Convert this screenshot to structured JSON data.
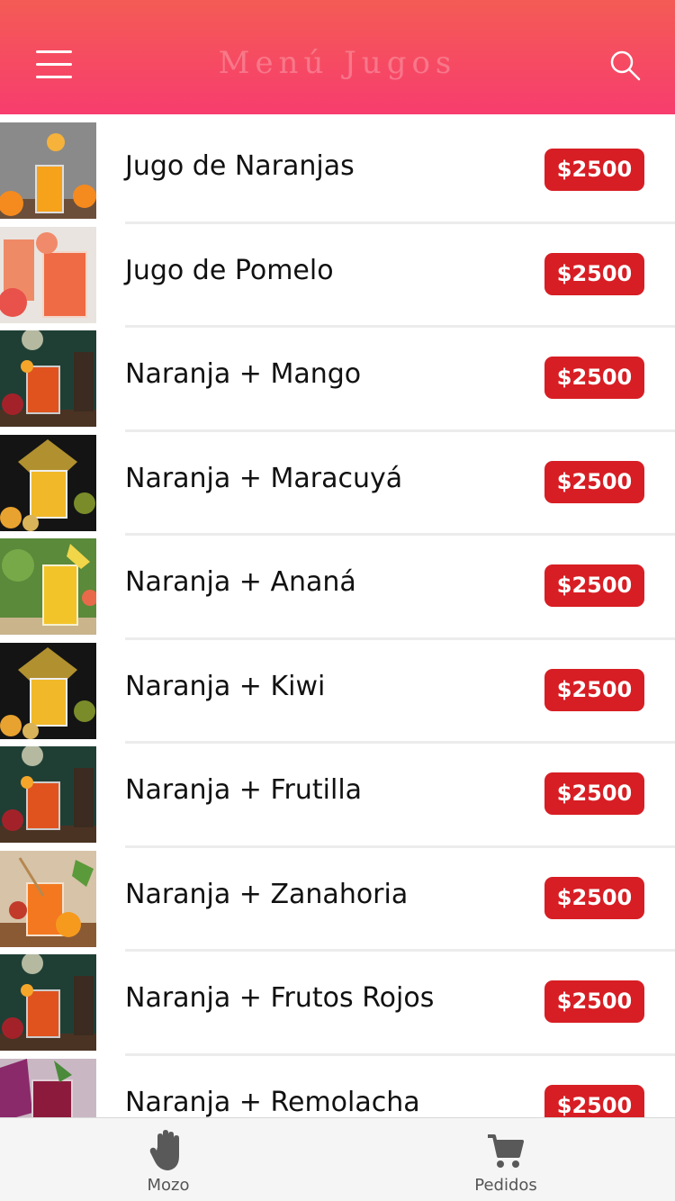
{
  "header": {
    "title": "Menú Jugos",
    "menu_icon": "hamburger-menu-icon",
    "search_icon": "search-icon"
  },
  "colors": {
    "header_gradient_top": "#f45b55",
    "header_gradient_bottom": "#f73d6e",
    "price_badge": "#d71e24",
    "tabbar_background": "#f5f5f5"
  },
  "items": [
    {
      "name": "Jugo de Naranjas",
      "price": "$2500",
      "image": "orange-juice-photo"
    },
    {
      "name": "Jugo de Pomelo",
      "price": "$2500",
      "image": "grapefruit-juice-photo"
    },
    {
      "name": "Naranja + Mango",
      "price": "$2500",
      "image": "mango-juice-photo"
    },
    {
      "name": "Naranja + Maracuyá",
      "price": "$2500",
      "image": "passionfruit-juice-photo"
    },
    {
      "name": "Naranja + Ananá",
      "price": "$2500",
      "image": "pineapple-juice-photo"
    },
    {
      "name": "Naranja + Kiwi",
      "price": "$2500",
      "image": "kiwi-juice-photo"
    },
    {
      "name": "Naranja + Frutilla",
      "price": "$2500",
      "image": "strawberry-juice-photo"
    },
    {
      "name": "Naranja + Zanahoria",
      "price": "$2500",
      "image": "carrot-juice-photo"
    },
    {
      "name": "Naranja + Frutos Rojos",
      "price": "$2500",
      "image": "berries-juice-photo"
    },
    {
      "name": "Naranja + Remolacha",
      "price": "$2500",
      "image": "beet-juice-photo"
    }
  ],
  "tabbar": {
    "mozo_label": "Mozo",
    "mozo_icon": "hand-icon",
    "pedidos_label": "Pedidos",
    "pedidos_icon": "cart-icon"
  }
}
